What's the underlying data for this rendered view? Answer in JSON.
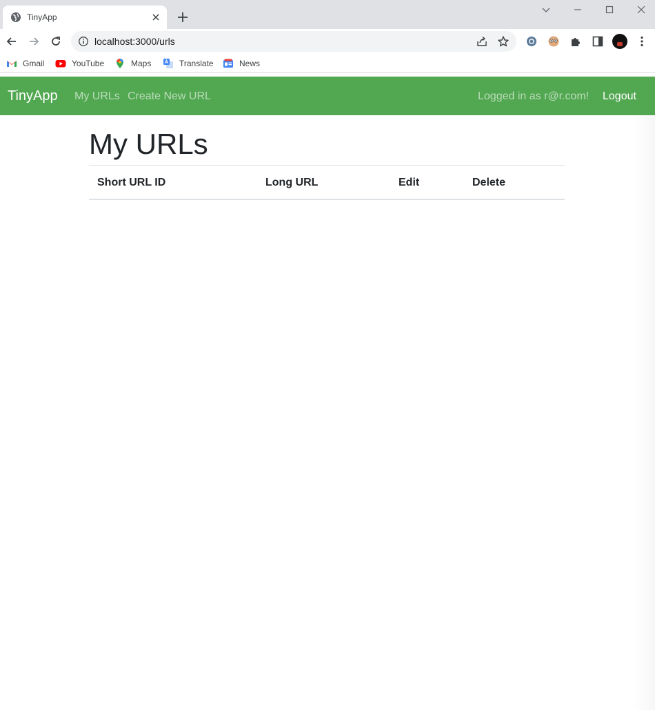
{
  "browser": {
    "tab": {
      "title": "TinyApp",
      "favicon": "globe-icon"
    },
    "address": {
      "url": "localhost:3000/urls"
    },
    "bookmarks": [
      {
        "label": "Gmail",
        "icon": "gmail-icon"
      },
      {
        "label": "YouTube",
        "icon": "youtube-icon"
      },
      {
        "label": "Maps",
        "icon": "maps-icon"
      },
      {
        "label": "Translate",
        "icon": "translate-icon"
      },
      {
        "label": "News",
        "icon": "news-icon"
      }
    ]
  },
  "navbar": {
    "brand": "TinyApp",
    "links": [
      "My URLs",
      "Create New URL"
    ],
    "logged_in": "Logged in as r@r.com!",
    "logout": "Logout",
    "color": "#52a751"
  },
  "main": {
    "title": "My URLs",
    "table": {
      "headers": [
        "Short URL ID",
        "Long URL",
        "Edit",
        "Delete"
      ],
      "rows": []
    }
  }
}
